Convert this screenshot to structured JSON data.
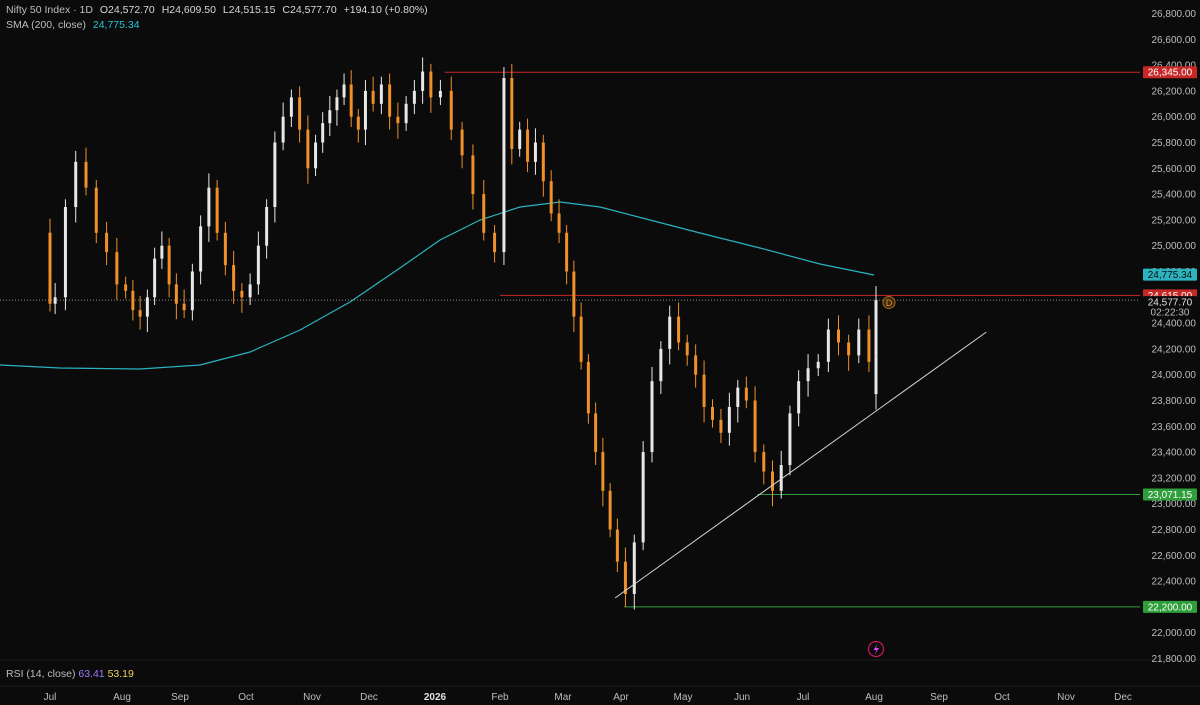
{
  "header": {
    "symbol": "Nifty 50 Index · 1D",
    "open": "O24,572.70",
    "high": "H24,609.50",
    "low": "L24,515.15",
    "close": "C24,577.70",
    "change": "+194.10 (+0.80%)",
    "sma_label": "SMA (200, close)",
    "sma_value": "24,775.34"
  },
  "rsi": {
    "label": "RSI (14, close)",
    "value1": "63.41",
    "value2": "53.19"
  },
  "price_tags": {
    "level_top": "26,345.00",
    "sma": "24,775.34",
    "level_mid": "24,615.00",
    "last": "24,577.70",
    "countdown": "02:22:30",
    "level_support": "23,071.15",
    "level_bottom": "22,200.00"
  },
  "marker": {
    "label": "D"
  },
  "colors": {
    "background": "#0b0b0b",
    "up_candle": "#e8e8e8",
    "down_candle": "#f0902a",
    "sma_line": "#2bb3c0",
    "resistance": "#c62828",
    "support": "#2e9e3a",
    "trendline": "#d9d9d9",
    "grid_text": "#bdbdbd"
  },
  "chart_data": {
    "type": "candlestick",
    "title": "Nifty 50 Index · 1D",
    "y_ticks": [
      21800,
      22000,
      22200,
      22400,
      22600,
      22800,
      23000,
      23200,
      23400,
      23600,
      23800,
      24000,
      24200,
      24400,
      24600,
      24800,
      25000,
      25200,
      25400,
      25600,
      25800,
      26000,
      26200,
      26400,
      26600,
      26800
    ],
    "ylim": [
      21750,
      26880
    ],
    "x_ticks": [
      {
        "label": "Jul",
        "index": 0
      },
      {
        "label": "Aug",
        "index": 1
      },
      {
        "label": "Sep",
        "index": 2
      },
      {
        "label": "Oct",
        "index": 3
      },
      {
        "label": "Nov",
        "index": 4
      },
      {
        "label": "Dec",
        "index": 5
      },
      {
        "label": "2026",
        "index": 6
      },
      {
        "label": "Feb",
        "index": 7
      },
      {
        "label": "Mar",
        "index": 8
      },
      {
        "label": "Apr",
        "index": 9
      },
      {
        "label": "May",
        "index": 10
      },
      {
        "label": "Jun",
        "index": 11
      },
      {
        "label": "Jul",
        "index": 12
      },
      {
        "label": "Aug",
        "index": 13
      },
      {
        "label": "Sep",
        "index": 14
      },
      {
        "label": "Oct",
        "index": 15
      },
      {
        "label": "Nov",
        "index": 16
      },
      {
        "label": "Dec",
        "index": 17
      }
    ],
    "horizontal_levels": [
      {
        "value": 26345.0,
        "color": "resistance",
        "from_month": 6.15
      },
      {
        "value": 24615.0,
        "color": "resistance",
        "from_month": 7.0
      },
      {
        "value": 23071.15,
        "color": "support",
        "from_month": 11.25
      },
      {
        "value": 22200.0,
        "color": "support",
        "from_month": 9.05
      }
    ],
    "trendline": {
      "from": {
        "month": 8.9,
        "value": 22270
      },
      "to": {
        "month": 14.75,
        "value": 24330
      }
    },
    "closes_by_month": [
      {
        "month": "Jun",
        "values": [
          24900,
          25100,
          24800,
          24750,
          24550
        ]
      },
      {
        "month": "Jul",
        "values": [
          24600,
          25300,
          25650,
          25450,
          25100,
          24950,
          24700
        ]
      },
      {
        "month": "Aug",
        "values": [
          24650,
          24500,
          24450,
          24600,
          24900,
          25000,
          24700,
          24550
        ]
      },
      {
        "month": "Sep",
        "values": [
          24500,
          24800,
          25150,
          25450,
          25100,
          24850,
          24650,
          24600
        ]
      },
      {
        "month": "Oct",
        "values": [
          24700,
          25000,
          25300,
          25800,
          26000,
          26150,
          25900,
          25600
        ]
      },
      {
        "month": "Nov",
        "values": [
          25800,
          25950,
          26050,
          26150,
          26250,
          26000,
          25900,
          26200
        ]
      },
      {
        "month": "Dec",
        "values": [
          26100,
          26250,
          26000,
          25950,
          26100,
          26200,
          26350,
          26150
        ]
      },
      {
        "month": "Jan",
        "values": [
          26200,
          25900,
          25700,
          25400,
          25100,
          24950
        ]
      },
      {
        "month": "Feb",
        "values": [
          26300,
          25750,
          25900,
          25650,
          25800,
          25500,
          25250,
          25100
        ]
      },
      {
        "month": "Mar",
        "values": [
          24800,
          24450,
          24100,
          23700,
          23400,
          23100,
          22800,
          22550
        ]
      },
      {
        "month": "Apr",
        "values": [
          22300,
          22700,
          23400,
          23950,
          24200,
          24450,
          24250
        ]
      },
      {
        "month": "May",
        "values": [
          24150,
          24000,
          23750,
          23650,
          23550,
          23750,
          23900
        ]
      },
      {
        "month": "Jun",
        "values": [
          23800,
          23400,
          23250,
          23100,
          23300,
          23700,
          23950
        ]
      },
      {
        "month": "Jul",
        "values": [
          24050,
          24100,
          24350,
          24250,
          24150,
          24350,
          24100
        ]
      },
      {
        "month": "Aug",
        "values": [
          23850,
          24150,
          24577.7
        ]
      }
    ],
    "last_price": 24577.7,
    "sma": {
      "name": "SMA (200, close)",
      "last_value": 24775.34
    }
  }
}
